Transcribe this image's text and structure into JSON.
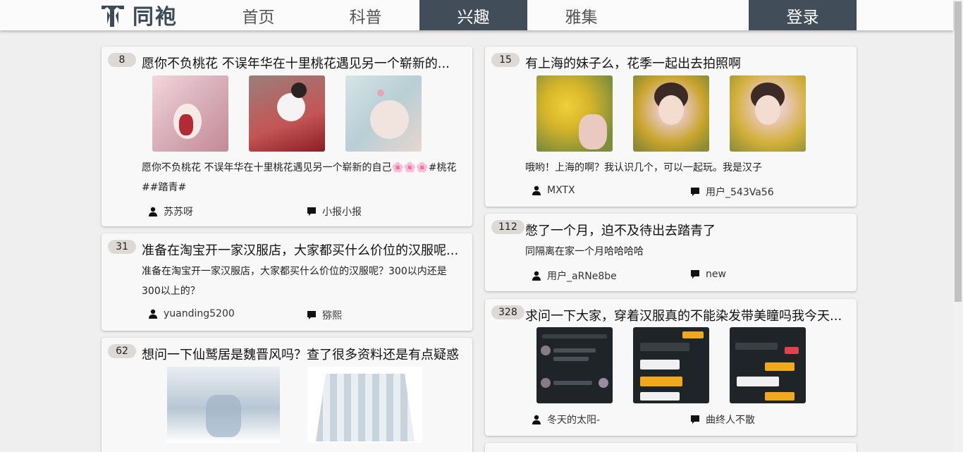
{
  "header": {
    "logo_text": "同袍",
    "nav": [
      {
        "label": "首页",
        "active": false
      },
      {
        "label": "科普",
        "active": false
      },
      {
        "label": "兴趣",
        "active": true
      },
      {
        "label": "雅集",
        "active": false
      }
    ],
    "login_label": "登录",
    "colors": {
      "active_bg": "#424d5a",
      "header_bg": "#fbfbfb"
    }
  },
  "posts": [
    {
      "count": "8",
      "title": "愿你不负桃花 不误年华在十里桃花遇见另一个崭新的...",
      "body": "愿你不负桃花 不误年华在十里桃花遇见另一个崭新的自己🌸🌸🌸#桃花##踏青#",
      "user": "苏苏呀",
      "tag": "小报小报"
    },
    {
      "count": "31",
      "title": "准备在淘宝开一家汉服店，大家都买什么价位的汉服呢...",
      "body": "准备在淘宝开一家汉服店，大家都买什么价位的汉服呢？300以内还是300以上的？",
      "user": "yuanding5200",
      "tag": "猕熙"
    },
    {
      "count": "62",
      "title": "想问一下仙鹫居是魏晋风吗？查了很多资料还是有点疑惑"
    },
    {
      "count": "15",
      "title": "有上海的妹子么，花季一起出去拍照啊",
      "body": "哦哟！上海的啊？我认识几个，可以一起玩。我是汉子",
      "user": "MXTX",
      "tag": "用户_543Va56"
    },
    {
      "count": "112",
      "title": "憋了一个月，迫不及待出去踏青了",
      "body": "同隔离在家一个月哈哈哈哈",
      "user": "用户_aRNe8be",
      "tag": "new"
    },
    {
      "count": "328",
      "title": "求问一下大家，穿着汉服真的不能染发带美瞳吗我今天...",
      "user": "冬天的太阳-",
      "tag": "曲终人不散"
    }
  ]
}
